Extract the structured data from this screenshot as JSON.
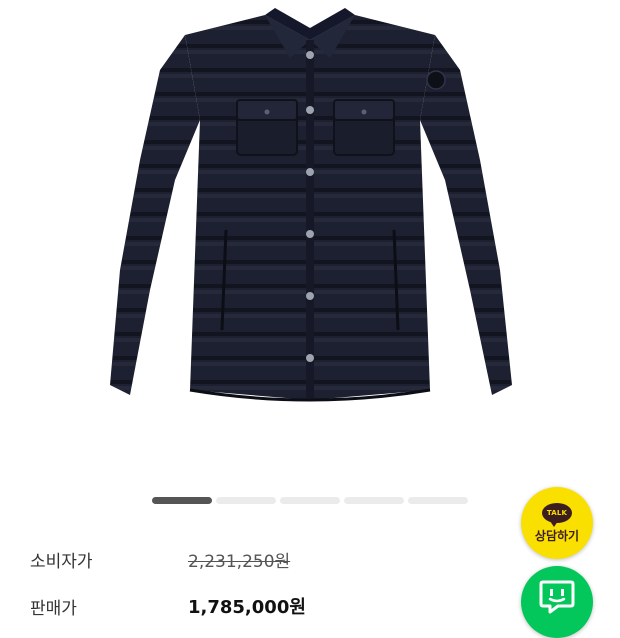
{
  "product": {
    "image_alt": "navy quilted down shirt jacket",
    "image_count": 5,
    "active_slide": 1
  },
  "prices": {
    "consumer_label": "소비자가",
    "consumer_price": "2,231,250원",
    "sale_label": "판매가",
    "sale_price": "1,785,000원"
  },
  "kakao": {
    "badge": "TALK",
    "label": "상담하기",
    "icon": "kakao-talk-icon",
    "color": "#f9e000"
  },
  "naver": {
    "icon": "naver-talk-icon",
    "color": "#03c75a"
  }
}
